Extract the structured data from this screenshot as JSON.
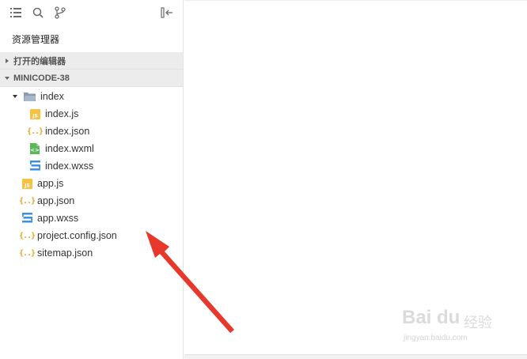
{
  "explorer": {
    "title": "资源管理器",
    "open_editors_label": "打开的编辑器",
    "project_label": "MINICODE-38"
  },
  "tree": {
    "folder": {
      "name": "index"
    },
    "folder_files": [
      {
        "name": "index.js",
        "icon": "js-file-icon"
      },
      {
        "name": "index.json",
        "icon": "json-file-icon"
      },
      {
        "name": "index.wxml",
        "icon": "wxml-file-icon"
      },
      {
        "name": "index.wxss",
        "icon": "wxss-file-icon"
      }
    ],
    "root_files": [
      {
        "name": "app.js",
        "icon": "js-file-icon"
      },
      {
        "name": "app.json",
        "icon": "json-file-icon"
      },
      {
        "name": "app.wxss",
        "icon": "wxss-file-icon"
      },
      {
        "name": "project.config.json",
        "icon": "json-file-icon"
      },
      {
        "name": "sitemap.json",
        "icon": "json-file-icon"
      }
    ]
  },
  "icons": {
    "toolbar": [
      "list-icon",
      "search-icon",
      "source-control-icon",
      "collapse-sidebar-icon"
    ]
  },
  "colors": {
    "js": "#f5c242",
    "json": "#e6a521",
    "wxml": "#5bb75b",
    "wxss": "#3d8fe8",
    "folder": "#8a9bb0",
    "arrow_annotation": "#e8382c"
  },
  "watermark": {
    "main": "Bai du",
    "cn": "经验",
    "url": "jingyan.baidu.com"
  }
}
